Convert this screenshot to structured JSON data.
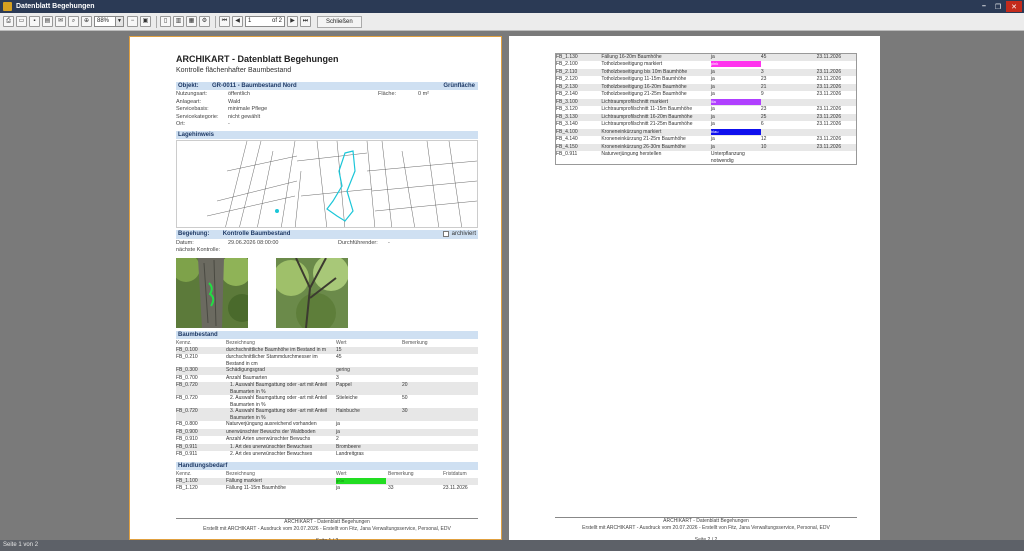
{
  "window": {
    "title": "Datenblatt Begehungen"
  },
  "toolbar": {
    "zoom": "88%",
    "page_current": "1",
    "page_of": "of 2",
    "close_label": "Schließen"
  },
  "status": {
    "text": "Seite 1 von 2"
  },
  "page1": {
    "title": "ARCHIKART - Datenblatt Begehungen",
    "subtitle": "Kontrolle flächenhafter Baumbestand",
    "objekt": {
      "label": "Objekt:",
      "value": "GR-0011 - Baumbestand Nord",
      "right": "Grünfläche",
      "rows": [
        {
          "k": "Nutzungsart:",
          "v": "öffentlich",
          "k2": "Fläche:",
          "v2": "0 m²"
        },
        {
          "k": "Anlageart:",
          "v": "Wald",
          "k2": "",
          "v2": ""
        },
        {
          "k": "Servicebasis:",
          "v": "minimale Pflege",
          "k2": "",
          "v2": ""
        },
        {
          "k": "Servicekategorie:",
          "v": "nicht gewählt",
          "k2": "",
          "v2": ""
        },
        {
          "k": "Ort:",
          "v": "-",
          "k2": "",
          "v2": ""
        }
      ]
    },
    "lagehinweis": "Lagehinweis",
    "begehung": {
      "label": "Begehung:",
      "value": "Kontrolle Baumbestand",
      "archiviert": "archiviert",
      "datum_label": "Datum:",
      "datum": "29.06.2026 08:00:00",
      "durch_label": "Durchführender:",
      "durch": "-",
      "naechste": "nächste Kontrolle:"
    },
    "baumbestand": {
      "title": "Baumbestand",
      "headers": [
        "Kennz.",
        "Bezeichnung",
        "Wert",
        "Bemerkung"
      ],
      "rows": [
        [
          "FB_0.100",
          "durchschnittliche Baumhöhe im Bestand in m",
          "15",
          ""
        ],
        [
          "FB_0.210",
          "durchschnittlicher Stammdurchmesser im Bestand in cm",
          "45",
          ""
        ],
        [
          "FB_0.300",
          "Schädigungsgrad",
          "gering",
          ""
        ],
        [
          "FB_0.700",
          "Anzahl Baumarten",
          "3",
          ""
        ],
        [
          "FB_0.720",
          "1. Auswahl Baumgattung oder -art mit Anteil Baumarten in %",
          "Pappel",
          "20"
        ],
        [
          "FB_0.720",
          "2. Auswahl Baumgattung oder -art mit Anteil Baumarten in %",
          "Stieleiche",
          "50"
        ],
        [
          "FB_0.720",
          "3. Auswahl Baumgattung oder -art mit Anteil Baumarten in %",
          "Hainbuche",
          "30"
        ],
        [
          "FB_0.800",
          "Naturverjüngung ausreichend vorhanden",
          "ja",
          ""
        ],
        [
          "FB_0.900",
          "unerwünschter Bewuchs der Waldboden",
          "ja",
          ""
        ],
        [
          "FB_0.910",
          "Anzahl Arten unerwünschter Bewuchs",
          "2",
          ""
        ],
        [
          "FB_0.911",
          "1. Art des unerwünschter Bewuchses",
          "Brombeere",
          ""
        ],
        [
          "FB_0.911",
          "2. Art des unerwünschter Bewuchses",
          "Landreitgras",
          ""
        ]
      ]
    },
    "handlung": {
      "title": "Handlungsbedarf",
      "headers": [
        "Kennz.",
        "Bezeichnung",
        "Wert",
        "Bemerkung",
        "Fristdatum"
      ],
      "rows": [
        [
          "FB_1.100",
          "Fällung markiert",
          "grün",
          "",
          ""
        ],
        [
          "FB_1.120",
          "Fällung 11-15m Baumhöhe",
          "ja",
          "33",
          "23.11.2026"
        ]
      ],
      "swatch_color": "#22dd22"
    },
    "footer": {
      "line1": "ARCHIKART - Datenblatt Begehungen",
      "line2": "Erstellt mit ARCHIKART - Ausdruck vom 20.07.2026 - Erstellt von Fitz, Jana Verwaltungsservice, Personal, EDV",
      "page": "Seite 1 / 2"
    }
  },
  "page2": {
    "rows": [
      [
        "FB_1.130",
        "Fällung 16-20m Baumhöhe",
        "ja",
        "45",
        "23.11.2026",
        ""
      ],
      [
        "FB_2.100",
        "Totholzbeseitigung markiert",
        "pink",
        "",
        "",
        "#ff33ee"
      ],
      [
        "FB_2.110",
        "Totholzbeseitigung bis 10m Baumhöhe",
        "ja",
        "3",
        "23.11.2026",
        ""
      ],
      [
        "FB_2.120",
        "Totholzbeseitigung 11-15m Baumhöhe",
        "ja",
        "23",
        "23.11.2026",
        ""
      ],
      [
        "FB_2.130",
        "Totholzbeseitigung 16-20m Baumhöhe",
        "ja",
        "21",
        "23.11.2026",
        ""
      ],
      [
        "FB_2.140",
        "Totholzbeseitigung 21-25m Baumhöhe",
        "ja",
        "9",
        "23.11.2026",
        ""
      ],
      [
        "FB_3.100",
        "Lichtraumprofilschnitt markiert",
        "lila",
        "",
        "",
        "#b040ff"
      ],
      [
        "FB_3.120",
        "Lichtraumprofilschnitt 11-15m Baumhöhe",
        "ja",
        "23",
        "23.11.2026",
        ""
      ],
      [
        "FB_3.130",
        "Lichtraumprofilschnitt 16-20m Baumhöhe",
        "ja",
        "25",
        "23.11.2026",
        ""
      ],
      [
        "FB_3.140",
        "Lichtraumprofilschnitt 21-25m Baumhöhe",
        "ja",
        "6",
        "23.11.2026",
        ""
      ],
      [
        "FB_4.100",
        "Kroneneinkürzung markiert",
        "blau",
        "",
        "",
        "#1010ee"
      ],
      [
        "FB_4.140",
        "Kroneneinkürzung 21-25m Baumhöhe",
        "ja",
        "12",
        "23.11.2026",
        ""
      ],
      [
        "FB_4.150",
        "Kroneneinkürzung 26-30m Baumhöhe",
        "ja",
        "10",
        "23.11.2026",
        ""
      ],
      [
        "FB_0.911",
        "Naturverjüngung herstellen",
        "Unterpflanzung notwendig",
        "",
        "",
        ""
      ]
    ],
    "footer": {
      "line1": "ARCHIKART - Datenblatt Begehungen",
      "line2": "Erstellt mit ARCHIKART - Ausdruck vom 20.07.2026 - Erstellt von Fitz, Jana Verwaltungsservice, Personal, EDV",
      "page": "Seite 2 / 2"
    }
  }
}
